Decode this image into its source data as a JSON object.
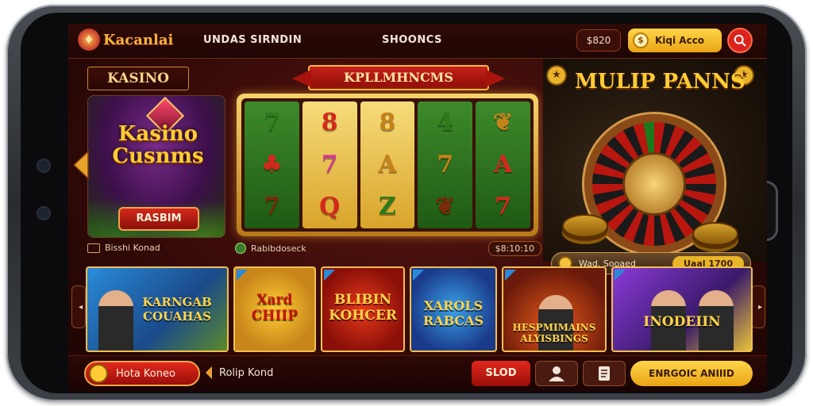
{
  "header": {
    "logo_text": "Kacanlai",
    "nav_left": "UNDAS SIRNDIN",
    "nav_center": "SHOONCS",
    "balance": "$820",
    "action_label": "Kiqi Acco",
    "icons": {
      "logo": "casino-chip-icon",
      "search": "search-icon",
      "coin": "coin-icon"
    }
  },
  "left_panel": {
    "section_tag": "KASINO",
    "promo_title": "Kasino Cusnms",
    "promo_button": "RASBIM",
    "footer_text": "Bisshi Konad"
  },
  "slot": {
    "banner": "KPLLMHNCMS",
    "reels": [
      [
        "7",
        "♣",
        "7"
      ],
      [
        "8",
        "7",
        "Q"
      ],
      [
        "8",
        "A",
        "Z"
      ],
      [
        "4",
        "7",
        "❦"
      ],
      [
        "❦",
        "A",
        "7"
      ]
    ],
    "footer_left": "Rabibdoseck",
    "footer_right": "$8:10:10"
  },
  "roulette": {
    "title": "MULIP PANNS",
    "bar_label": "Wad. Sooaed",
    "bar_amount": "Uaal 1700"
  },
  "games": [
    {
      "title": "KARNGAB COUAHAS"
    },
    {
      "title": "Xard CHIIP"
    },
    {
      "title": "BLIBIN KOHCER"
    },
    {
      "title": "XAROLS RABCAS"
    },
    {
      "title": "HESPMIMAINS ALYISBINGS"
    },
    {
      "title": "INODEIIN"
    }
  ],
  "bottom_bar": {
    "main_button": "Hota Koneo",
    "next_label": "Rolip Kond",
    "slot_button": "SLOD",
    "cta_button": "ENRGOIC ANIIID",
    "icons": {
      "user": "user-icon",
      "doc": "document-icon"
    }
  },
  "colors": {
    "accent_gold": "#f4b23a",
    "accent_red": "#d9231c",
    "background": "#2c0806"
  }
}
